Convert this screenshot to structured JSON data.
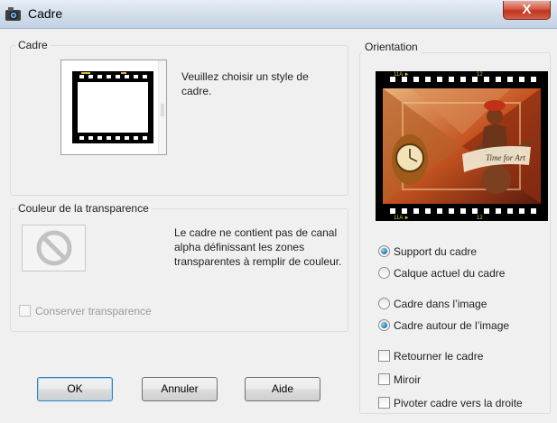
{
  "window": {
    "title": "Cadre",
    "close_label": "X"
  },
  "cadre_group": {
    "label": "Cadre",
    "prompt": "Veuillez choisir un style de cadre."
  },
  "transparency_group": {
    "label": "Couleur de la transparence",
    "message": "Le cadre ne contient pas de canal alpha définissant les zones transparentes à remplir de couleur.",
    "keep_transparency": {
      "label": "Conserver transparence",
      "checked": false,
      "enabled": false
    }
  },
  "orientation_group": {
    "label": "Orientation",
    "film_labels": {
      "left": "11A ►",
      "right": "12"
    },
    "image_text": "Time for Art",
    "apply_to": [
      {
        "label": "Support du cadre",
        "selected": true
      },
      {
        "label": "Calque actuel du cadre",
        "selected": false
      }
    ],
    "placement": [
      {
        "label": "Cadre dans l’image",
        "selected": false
      },
      {
        "label": "Cadre autour de l’image",
        "selected": true
      }
    ],
    "options": [
      {
        "label": "Retourner le cadre",
        "checked": false
      },
      {
        "label": "Miroir",
        "checked": false
      },
      {
        "label": "Pivoter cadre vers la droite",
        "checked": false
      }
    ]
  },
  "buttons": {
    "ok": "OK",
    "cancel": "Annuler",
    "help": "Aide"
  },
  "colors": {
    "accent": "#1672b0",
    "film": "#000000",
    "close": "#c0331b"
  }
}
